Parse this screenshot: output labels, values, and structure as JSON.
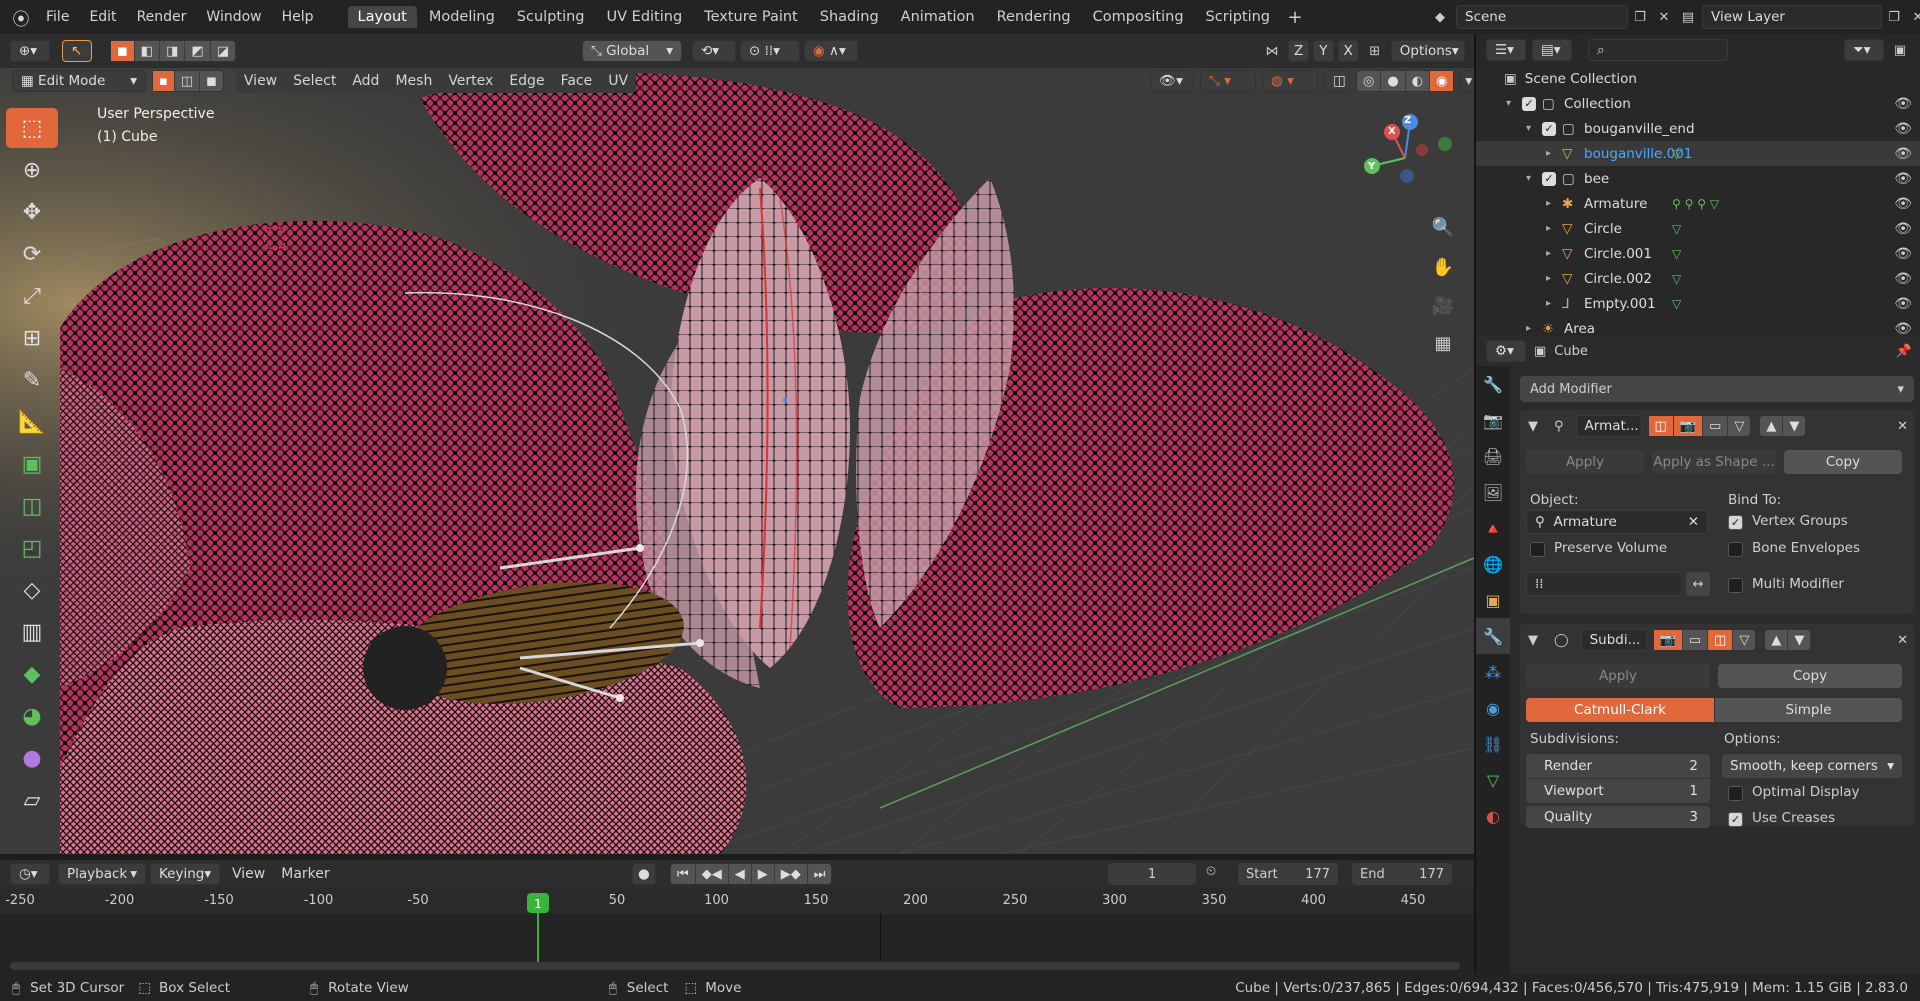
{
  "topbar": {
    "menus": [
      "File",
      "Edit",
      "Render",
      "Window",
      "Help"
    ],
    "workspaces": [
      "Layout",
      "Modeling",
      "Sculpting",
      "UV Editing",
      "Texture Paint",
      "Shading",
      "Animation",
      "Rendering",
      "Compositing",
      "Scripting"
    ],
    "active_workspace": "Layout",
    "scene_label": "Scene",
    "view_layer_label": "View Layer"
  },
  "viewport_header1": {
    "orientation": "Global",
    "axes": [
      "X",
      "Y",
      "Z"
    ],
    "options_label": "Options"
  },
  "viewport_header2": {
    "mode": "Edit Mode",
    "menus": [
      "View",
      "Select",
      "Add",
      "Mesh",
      "Vertex",
      "Edge",
      "Face",
      "UV"
    ]
  },
  "viewport": {
    "perspective_label": "User Perspective",
    "object_label": "(1) Cube",
    "gizmo_axes": [
      "Z",
      "Y",
      "X"
    ]
  },
  "tools": [
    "select-box-icon",
    "cursor-icon",
    "move-icon",
    "rotate-icon",
    "scale-icon",
    "transform-icon",
    "annotate-icon",
    "measure-icon",
    "add-cube-icon",
    "extrude-icon",
    "inset-icon",
    "bevel-icon",
    "loop-cut-icon",
    "knife-icon",
    "poly-build-icon",
    "spin-icon",
    "smooth-icon",
    "shear-icon"
  ],
  "outliner": {
    "header": "Scene Collection",
    "rows": [
      {
        "name": "Collection",
        "indent": 1,
        "type": "collection"
      },
      {
        "name": "bouganville_end",
        "indent": 2,
        "type": "collection"
      },
      {
        "name": "bouganville.001",
        "indent": 3,
        "type": "mesh",
        "selected": true
      },
      {
        "name": "bee",
        "indent": 2,
        "type": "collection"
      },
      {
        "name": "Armature",
        "indent": 3,
        "type": "armature"
      },
      {
        "name": "Circle",
        "indent": 3,
        "type": "mesh"
      },
      {
        "name": "Circle.001",
        "indent": 3,
        "type": "mesh"
      },
      {
        "name": "Circle.002",
        "indent": 3,
        "type": "mesh"
      },
      {
        "name": "Empty.001",
        "indent": 3,
        "type": "empty"
      },
      {
        "name": "Area",
        "indent": 2,
        "type": "light"
      }
    ]
  },
  "properties": {
    "object_name": "Cube",
    "add_modifier": "Add Modifier",
    "armature_mod": {
      "name": "Armat...",
      "apply": "Apply",
      "apply_shape": "Apply as Shape ...",
      "copy": "Copy",
      "object_label": "Object:",
      "object_value": "Armature",
      "bind_to_label": "Bind To:",
      "vertex_groups": "Vertex Groups",
      "vertex_groups_checked": true,
      "preserve_volume": "Preserve Volume",
      "preserve_volume_checked": false,
      "bone_envelopes": "Bone Envelopes",
      "bone_envelopes_checked": false,
      "multi_modifier": "Multi Modifier",
      "multi_modifier_checked": false
    },
    "subdiv_mod": {
      "name": "Subdi...",
      "apply": "Apply",
      "copy": "Copy",
      "type_active": "Catmull-Clark",
      "type_other": "Simple",
      "subdivisions_label": "Subdivisions:",
      "render_label": "Render",
      "render_value": "2",
      "viewport_label": "Viewport",
      "viewport_value": "1",
      "quality_label": "Quality",
      "quality_value": "3",
      "options_label": "Options:",
      "uv_smooth": "Smooth, keep corners",
      "optimal_display": "Optimal Display",
      "optimal_display_checked": false,
      "use_creases": "Use Creases",
      "use_creases_checked": true
    }
  },
  "timeline": {
    "menus": [
      "Playback",
      "Keying",
      "View",
      "Marker"
    ],
    "current_frame": "1",
    "start_label": "Start",
    "start_value": "177",
    "end_label": "End",
    "end_value": "177",
    "ruler": [
      "-250",
      "-200",
      "-150",
      "-100",
      "-50",
      "1",
      "50",
      "100",
      "150",
      "200",
      "250",
      "300",
      "350",
      "400",
      "450"
    ]
  },
  "statusbar": {
    "hints": [
      "Set 3D Cursor",
      "Box Select",
      "Rotate View",
      "Select",
      "Move"
    ],
    "stats": "Cube | Verts:0/237,865 | Edges:0/694,432 | Faces:0/456,570 | Tris:475,919 | Mem: 1.15 GiB | 2.83.0"
  },
  "colors": {
    "accent": "#e0683a",
    "selected_text": "#4aa8ff",
    "mesh_icon": "#e8a84c",
    "green": "#5ec05e"
  }
}
